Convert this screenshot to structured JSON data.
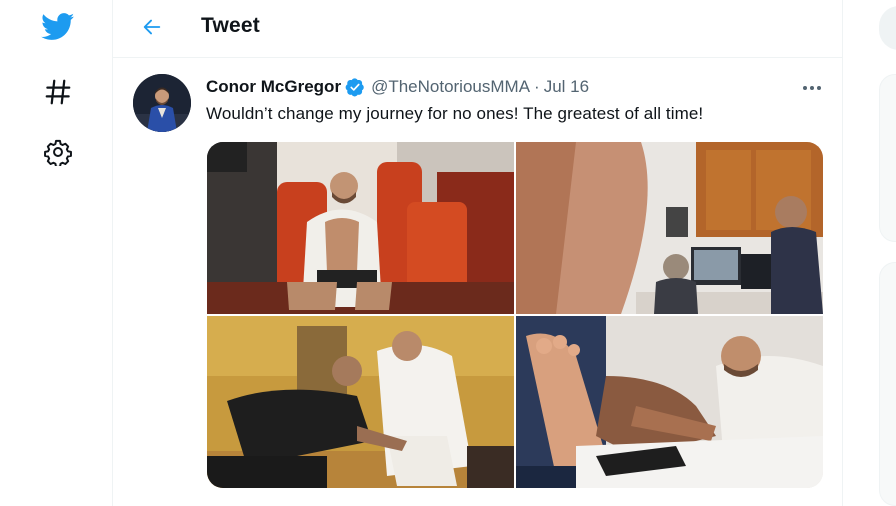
{
  "nav": {
    "logo_icon": "twitter-bird-icon",
    "explore_icon": "hashtag-icon",
    "settings_icon": "gear-icon"
  },
  "header": {
    "back_icon": "arrow-left-icon",
    "title": "Tweet"
  },
  "tweet": {
    "author_name": "Conor McGregor",
    "verified_icon": "verified-badge-icon",
    "handle": "@TheNotoriousMMA",
    "separator": "·",
    "date": "Jul 16",
    "more_icon": "more-horizontal-icon",
    "text": "Wouldn’t change my journey for no ones! The greatest of all time!",
    "media": [
      {
        "depicts": "man-seated-in-red-leather-car-seats"
      },
      {
        "depicts": "doctor-office-with-monitors"
      },
      {
        "depicts": "man-examining-foot-in-clinic"
      },
      {
        "depicts": "close-up-foot-examination"
      }
    ]
  },
  "colors": {
    "accent": "#1d9bf0",
    "text_primary": "#0f1419",
    "text_secondary": "#536471",
    "border": "#eff3f4"
  }
}
